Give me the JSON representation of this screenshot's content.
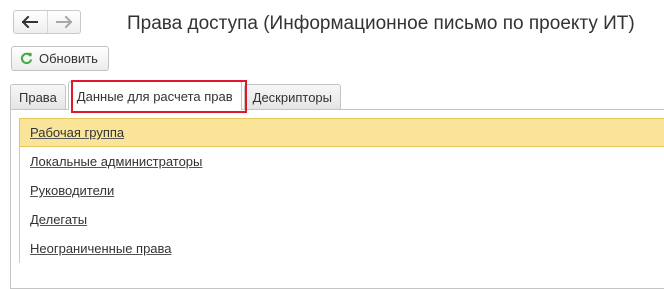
{
  "window": {
    "title": "Права доступа (Информационное письмо по проекту ИТ)"
  },
  "toolbar": {
    "refresh_label": "Обновить",
    "refresh_icon": "refresh-icon",
    "back_icon": "arrow-left-icon",
    "forward_icon": "arrow-right-icon"
  },
  "tabs": [
    {
      "label": "Права",
      "active": false
    },
    {
      "label": "Данные для расчета прав",
      "active": true
    },
    {
      "label": "Дескрипторы",
      "active": false
    }
  ],
  "list": {
    "items": [
      {
        "label": "Рабочая группа",
        "selected": true
      },
      {
        "label": "Локальные администраторы",
        "selected": false
      },
      {
        "label": "Руководители",
        "selected": false
      },
      {
        "label": "Делегаты",
        "selected": false
      },
      {
        "label": "Неограниченные права",
        "selected": false
      }
    ]
  },
  "colors": {
    "selection_bg": "#fae499",
    "highlight_frame": "#e2182a",
    "refresh_icon": "#3fae3f"
  }
}
